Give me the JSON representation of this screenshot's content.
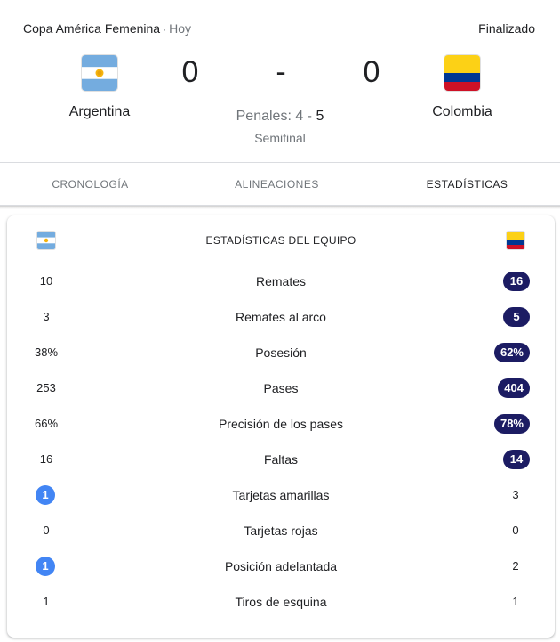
{
  "match": {
    "competition": "Copa América Femenina",
    "separator": "·",
    "day": "Hoy",
    "status": "Finalizado",
    "home": {
      "name": "Argentina",
      "score": "0",
      "flag_icon": "argentina-flag-icon"
    },
    "away": {
      "name": "Colombia",
      "score": "0",
      "flag_icon": "colombia-flag-icon"
    },
    "dash": "-",
    "penalties_prefix": "Penales: 4 - ",
    "penalties_winner_score": "5",
    "round": "Semifinal"
  },
  "tabs": [
    {
      "label": "Cronología",
      "active": false
    },
    {
      "label": "Alineaciones",
      "active": false
    },
    {
      "label": "Estadísticas",
      "active": true
    }
  ],
  "stats_card": {
    "title": "ESTADÍSTICAS DEL EQUIPO",
    "rows": [
      {
        "label": "Remates",
        "home": "10",
        "away": "16",
        "highlight": "away"
      },
      {
        "label": "Remates al arco",
        "home": "3",
        "away": "5",
        "highlight": "away"
      },
      {
        "label": "Posesión",
        "home": "38%",
        "away": "62%",
        "highlight": "away"
      },
      {
        "label": "Pases",
        "home": "253",
        "away": "404",
        "highlight": "away"
      },
      {
        "label": "Precisión de los pases",
        "home": "66%",
        "away": "78%",
        "highlight": "away"
      },
      {
        "label": "Faltas",
        "home": "16",
        "away": "14",
        "highlight": "away"
      },
      {
        "label": "Tarjetas amarillas",
        "home": "1",
        "away": "3",
        "highlight": "home"
      },
      {
        "label": "Tarjetas rojas",
        "home": "0",
        "away": "0",
        "highlight": "none"
      },
      {
        "label": "Posición adelantada",
        "home": "1",
        "away": "2",
        "highlight": "home"
      },
      {
        "label": "Tiros de esquina",
        "home": "1",
        "away": "1",
        "highlight": "none"
      }
    ]
  },
  "colors": {
    "away_highlight": "#1c1c63",
    "home_highlight": "#4285f4",
    "argentina_blue": "#74acdf",
    "argentina_sun": "#f6b40e",
    "colombia_yellow": "#fcd116",
    "colombia_blue": "#003893",
    "colombia_red": "#ce1126"
  }
}
